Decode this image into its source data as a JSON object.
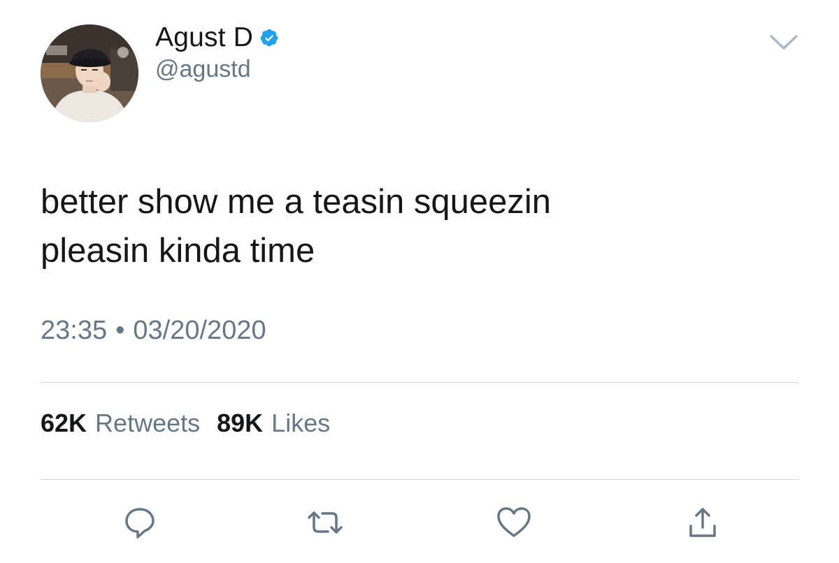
{
  "user": {
    "display_name": "Agust D",
    "handle": "@agustd",
    "verified": true,
    "avatar": "avatar-photo"
  },
  "tweet": {
    "text": "better show me a teasin squeezin\npleasin kinda time",
    "time": "23:35",
    "separator": "•",
    "date": "03/20/2020"
  },
  "stats": {
    "retweets_count": "62K",
    "retweets_label": "Retweets",
    "likes_count": "89K",
    "likes_label": "Likes"
  },
  "actions": {
    "reply_icon": "reply-icon",
    "retweet_icon": "retweet-icon",
    "like_icon": "heart-icon",
    "share_icon": "share-icon"
  },
  "menu": {
    "icon": "chevron-down-icon"
  },
  "colors": {
    "text_primary": "#14171a",
    "text_secondary": "#657786",
    "verified_blue": "#1da1f2",
    "icon_gray": "#657786",
    "divider": "#cfd5d9"
  }
}
